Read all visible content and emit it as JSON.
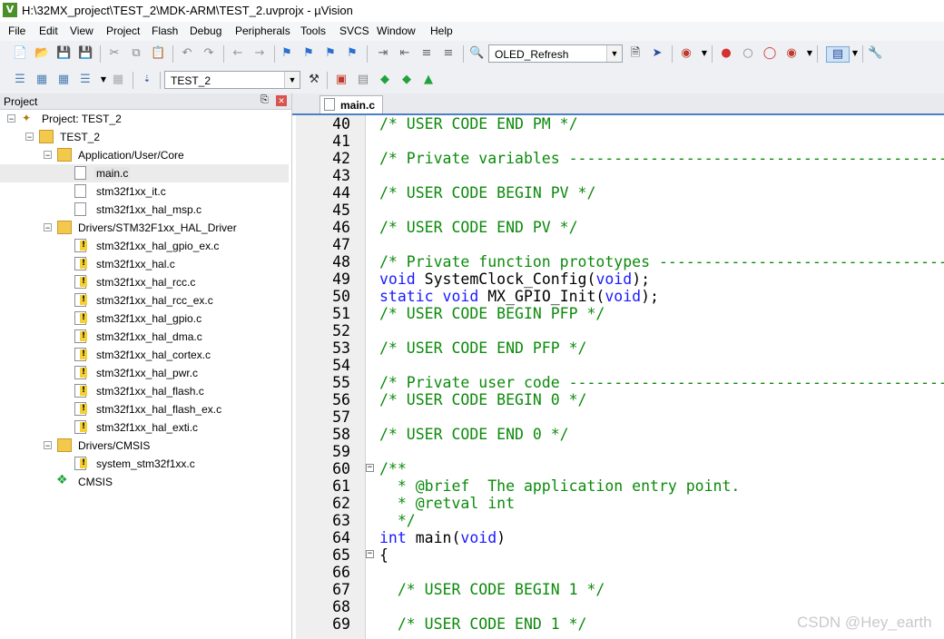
{
  "window": {
    "title": "H:\\32MX_project\\TEST_2\\MDK-ARM\\TEST_2.uvprojx - µVision",
    "app_icon": "V"
  },
  "menu": [
    "File",
    "Edit",
    "View",
    "Project",
    "Flash",
    "Debug",
    "Peripherals",
    "Tools",
    "SVCS",
    "Window",
    "Help"
  ],
  "toolbar": {
    "target_combo": "OLED_Refresh",
    "project_combo": "TEST_2"
  },
  "project_panel": {
    "title": "Project",
    "root": "Project: TEST_2",
    "target": "TEST_2",
    "groups": [
      {
        "name": "Application/User/Core",
        "files": [
          "main.c",
          "stm32f1xx_it.c",
          "stm32f1xx_hal_msp.c"
        ]
      },
      {
        "name": "Drivers/STM32F1xx_HAL_Driver",
        "files": [
          "stm32f1xx_hal_gpio_ex.c",
          "stm32f1xx_hal.c",
          "stm32f1xx_hal_rcc.c",
          "stm32f1xx_hal_rcc_ex.c",
          "stm32f1xx_hal_gpio.c",
          "stm32f1xx_hal_dma.c",
          "stm32f1xx_hal_cortex.c",
          "stm32f1xx_hal_pwr.c",
          "stm32f1xx_hal_flash.c",
          "stm32f1xx_hal_flash_ex.c",
          "stm32f1xx_hal_exti.c"
        ]
      },
      {
        "name": "Drivers/CMSIS",
        "files": [
          "system_stm32f1xx.c"
        ]
      }
    ],
    "extra": "CMSIS"
  },
  "editor": {
    "tab": "main.c",
    "lines": [
      {
        "n": "40",
        "t": "/* USER CODE END PM */",
        "c": "cm"
      },
      {
        "n": "41",
        "t": ""
      },
      {
        "n": "42",
        "t": "/* Private variables ----------------------------------------------",
        "c": "cm"
      },
      {
        "n": "43",
        "t": ""
      },
      {
        "n": "44",
        "t": "/* USER CODE BEGIN PV */",
        "c": "cm"
      },
      {
        "n": "45",
        "t": ""
      },
      {
        "n": "46",
        "t": "/* USER CODE END PV */",
        "c": "cm"
      },
      {
        "n": "47",
        "t": ""
      },
      {
        "n": "48",
        "t": "/* Private function prototypes ------------------------------------",
        "c": "cm"
      },
      {
        "n": "49",
        "t": "void SystemClock_Config(void);",
        "c": "mix"
      },
      {
        "n": "50",
        "t": "static void MX_GPIO_Init(void);",
        "c": "mix"
      },
      {
        "n": "51",
        "t": "/* USER CODE BEGIN PFP */",
        "c": "cm"
      },
      {
        "n": "52",
        "t": ""
      },
      {
        "n": "53",
        "t": "/* USER CODE END PFP */",
        "c": "cm"
      },
      {
        "n": "54",
        "t": ""
      },
      {
        "n": "55",
        "t": "/* Private user code ----------------------------------------------",
        "c": "cm"
      },
      {
        "n": "56",
        "t": "/* USER CODE BEGIN 0 */",
        "c": "cm"
      },
      {
        "n": "57",
        "t": ""
      },
      {
        "n": "58",
        "t": "/* USER CODE END 0 */",
        "c": "cm"
      },
      {
        "n": "59",
        "t": ""
      },
      {
        "n": "60",
        "t": "/**",
        "c": "cm",
        "fold": "−"
      },
      {
        "n": "61",
        "t": "  * @brief  The application entry point.",
        "c": "cm"
      },
      {
        "n": "62",
        "t": "  * @retval int",
        "c": "cm"
      },
      {
        "n": "63",
        "t": "  */",
        "c": "cm"
      },
      {
        "n": "64",
        "t": "int main(void)",
        "c": "mix"
      },
      {
        "n": "65",
        "t": "{",
        "fold": "−"
      },
      {
        "n": "66",
        "t": ""
      },
      {
        "n": "67",
        "t": "  /* USER CODE BEGIN 1 */",
        "c": "cm"
      },
      {
        "n": "68",
        "t": ""
      },
      {
        "n": "69",
        "t": "  /* USER CODE END 1 */",
        "c": "cm"
      }
    ]
  },
  "watermark": "CSDN @Hey_earth"
}
